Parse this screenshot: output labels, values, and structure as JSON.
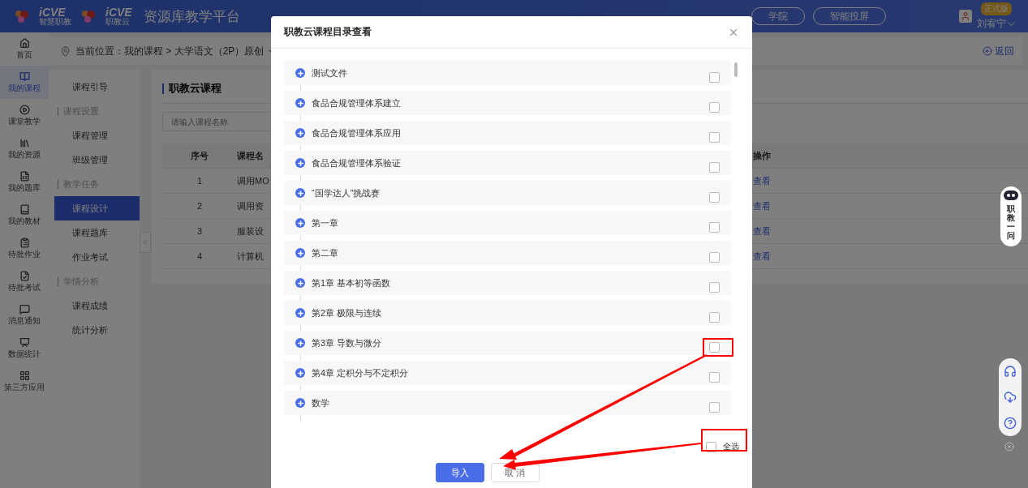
{
  "header": {
    "brands": [
      {
        "mark": "iCVE",
        "sub": "智慧职教"
      },
      {
        "mark": "iCVE",
        "sub": "职教云"
      }
    ],
    "platform": "资源库教学平台",
    "buttons": [
      "学院",
      "智能投屏"
    ],
    "user": {
      "badge": "正式版",
      "name": "刘宥宁"
    }
  },
  "nav": [
    {
      "label": "首页",
      "selected": false
    },
    {
      "label": "我的课程",
      "selected": true
    },
    {
      "label": "课堂教学",
      "selected": false
    },
    {
      "label": "我的资源",
      "selected": false
    },
    {
      "label": "我的题库",
      "selected": false
    },
    {
      "label": "我的教材",
      "selected": false
    },
    {
      "label": "待批作业",
      "selected": false
    },
    {
      "label": "待批考试",
      "selected": false
    },
    {
      "label": "消息通知",
      "selected": false
    },
    {
      "label": "数据统计",
      "selected": false
    },
    {
      "label": "第三方应用",
      "selected": false
    }
  ],
  "breadcrumb": "当前位置：我的课程 > 大学语文（2P）原创",
  "back": "返回",
  "subnav": [
    {
      "kind": "item",
      "label": "课程引导",
      "selected": false
    },
    {
      "kind": "section",
      "label": "课程设置"
    },
    {
      "kind": "item",
      "label": "课程管理",
      "selected": false
    },
    {
      "kind": "item",
      "label": "班级管理",
      "selected": false
    },
    {
      "kind": "section",
      "label": "教学任务"
    },
    {
      "kind": "item",
      "label": "课程设计",
      "selected": true
    },
    {
      "kind": "item",
      "label": "课程题库",
      "selected": false
    },
    {
      "kind": "item",
      "label": "作业考试",
      "selected": false
    },
    {
      "kind": "section",
      "label": "学情分析"
    },
    {
      "kind": "item",
      "label": "课程成绩",
      "selected": false
    },
    {
      "kind": "item",
      "label": "统计分析",
      "selected": false
    }
  ],
  "content": {
    "title": "职教云课程",
    "search": {
      "placeholder": "请输入课程名称"
    },
    "table": {
      "columns": [
        "序号",
        "课程名",
        "操作"
      ],
      "rows": [
        {
          "index": "1",
          "name": "调用MO",
          "action": "查看"
        },
        {
          "index": "2",
          "name": "调用资",
          "action": "查看"
        },
        {
          "index": "3",
          "name": "服装设",
          "action": "查看"
        },
        {
          "index": "4",
          "name": "计算机",
          "action": "查看"
        }
      ]
    }
  },
  "assistant": {
    "label": "职教一问"
  },
  "modal": {
    "title": "职教云课程目录查看",
    "items": [
      {
        "label": "测试文件",
        "checked": false
      },
      {
        "label": "食品合规管理体系建立",
        "checked": false
      },
      {
        "label": "食品合规管理体系应用",
        "checked": false
      },
      {
        "label": "食品合规管理体系验证",
        "checked": false
      },
      {
        "label": "“国学达人”挑战赛",
        "checked": false
      },
      {
        "label": "第一章",
        "checked": false
      },
      {
        "label": "第二章",
        "checked": false
      },
      {
        "label": "第1章 基本初等函数",
        "checked": false
      },
      {
        "label": "第2章 极限与连续",
        "checked": false
      },
      {
        "label": "第3章 导数与微分",
        "checked": false
      },
      {
        "label": "第4章 定积分与不定积分",
        "checked": false
      },
      {
        "label": "数学",
        "checked": false
      }
    ],
    "select_all": {
      "label": "全选",
      "checked": false
    },
    "buttons": [
      {
        "label": "导入",
        "kind": "primary"
      },
      {
        "label": "取 消",
        "kind": "default"
      }
    ]
  }
}
